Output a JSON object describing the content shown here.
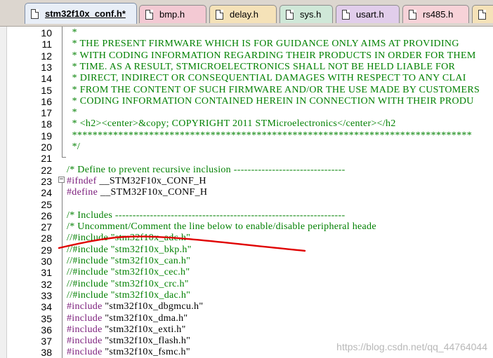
{
  "tabs": [
    {
      "label": "stm32f10x_conf.h*",
      "active": true,
      "color": "#e8eef7"
    },
    {
      "label": "bmp.h",
      "active": false,
      "color": "#f3c9d3"
    },
    {
      "label": "delay.h",
      "active": false,
      "color": "#f5e2b8"
    },
    {
      "label": "sys.h",
      "active": false,
      "color": "#cfe8d8"
    },
    {
      "label": "usart.h",
      "active": false,
      "color": "#e1cdeb"
    },
    {
      "label": "rs485.h",
      "active": false,
      "color": "#f7d2d8"
    },
    {
      "label": "",
      "active": false,
      "color": "#f5e2b8"
    }
  ],
  "editor": {
    "lines": [
      {
        "num": "10",
        "text": "  *",
        "kind": "cmt"
      },
      {
        "num": "11",
        "text": "  * THE PRESENT FIRMWARE WHICH IS FOR GUIDANCE ONLY AIMS AT PROVIDING",
        "kind": "cmt"
      },
      {
        "num": "12",
        "text": "  * WITH CODING INFORMATION REGARDING THEIR PRODUCTS IN ORDER FOR THEM",
        "kind": "cmt"
      },
      {
        "num": "13",
        "text": "  * TIME. AS A RESULT, STMICROELECTRONICS SHALL NOT BE HELD LIABLE FOR",
        "kind": "cmt"
      },
      {
        "num": "14",
        "text": "  * DIRECT, INDIRECT OR CONSEQUENTIAL DAMAGES WITH RESPECT TO ANY CLAI",
        "kind": "cmt"
      },
      {
        "num": "15",
        "text": "  * FROM THE CONTENT OF SUCH FIRMWARE AND/OR THE USE MADE BY CUSTOMERS",
        "kind": "cmt"
      },
      {
        "num": "16",
        "text": "  * CODING INFORMATION CONTAINED HEREIN IN CONNECTION WITH THEIR PRODU",
        "kind": "cmt"
      },
      {
        "num": "17",
        "text": "  *",
        "kind": "cmt"
      },
      {
        "num": "18",
        "text": "  * <h2><center>&copy; COPYRIGHT 2011 STMicroelectronics</center></h2",
        "kind": "cmt"
      },
      {
        "num": "19",
        "text": "  ******************************************************************************",
        "kind": "cmt"
      },
      {
        "num": "20",
        "text": "  */",
        "kind": "cmt"
      },
      {
        "num": "21",
        "text": "",
        "kind": "cmt"
      },
      {
        "num": "22",
        "text": "/* Define to prevent recursive inclusion --------------------------------",
        "kind": "cmt"
      },
      {
        "num": "23",
        "text": "#ifndef __STM32F10x_CONF_H",
        "kind": "dir"
      },
      {
        "num": "24",
        "text": "#define __STM32F10x_CONF_H",
        "kind": "dir"
      },
      {
        "num": "25",
        "text": "",
        "kind": "cmt"
      },
      {
        "num": "26",
        "text": "/* Includes ------------------------------------------------------------------",
        "kind": "cmt"
      },
      {
        "num": "27",
        "text": "/* Uncomment/Comment the line below to enable/disable peripheral heade",
        "kind": "cmt"
      },
      {
        "num": "28",
        "text": "//#include \"stm32f10x_adc.h\"",
        "kind": "cmt"
      },
      {
        "num": "29",
        "text": "//#include \"stm32f10x_bkp.h\"",
        "kind": "cmt"
      },
      {
        "num": "30",
        "text": "//#include \"stm32f10x_can.h\"",
        "kind": "cmt"
      },
      {
        "num": "31",
        "text": "//#include \"stm32f10x_cec.h\"",
        "kind": "cmt"
      },
      {
        "num": "32",
        "text": "//#include \"stm32f10x_crc.h\"",
        "kind": "cmt"
      },
      {
        "num": "33",
        "text": "//#include \"stm32f10x_dac.h\"",
        "kind": "cmt"
      },
      {
        "num": "34",
        "text": "#include \"stm32f10x_dbgmcu.h\"",
        "kind": "dir"
      },
      {
        "num": "35",
        "text": "#include \"stm32f10x_dma.h\"",
        "kind": "dir"
      },
      {
        "num": "36",
        "text": "#include \"stm32f10x_exti.h\"",
        "kind": "dir"
      },
      {
        "num": "37",
        "text": "#include \"stm32f10x_flash.h\"",
        "kind": "dir"
      },
      {
        "num": "38",
        "text": "#include \"stm32f10x_fsmc.h\"",
        "kind": "dir"
      }
    ],
    "fold_marker": "−"
  },
  "annotation": {
    "color": "#e00000"
  },
  "watermark": "https://blog.csdn.net/qq_44764044"
}
